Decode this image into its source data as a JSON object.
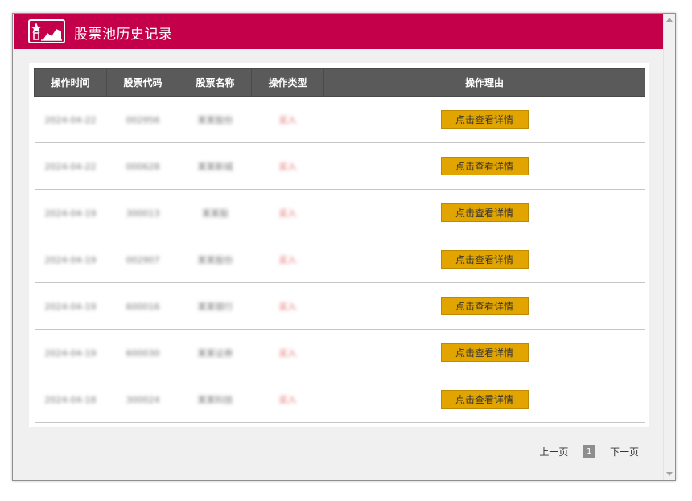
{
  "header": {
    "title": "股票池历史记录",
    "background_color": "#c5004a"
  },
  "table": {
    "columns": [
      "操作时间",
      "股票代码",
      "股票名称",
      "操作类型",
      "操作理由"
    ],
    "rows": [
      {
        "time": "2024-04-22",
        "code": "002956",
        "name": "某某股份",
        "type": "买入",
        "reason_button": "点击查看详情"
      },
      {
        "time": "2024-04-22",
        "code": "000628",
        "name": "某某新城",
        "type": "买入",
        "reason_button": "点击查看详情"
      },
      {
        "time": "2024-04-19",
        "code": "300013",
        "name": "某某股",
        "type": "买入",
        "reason_button": "点击查看详情"
      },
      {
        "time": "2024-04-19",
        "code": "002907",
        "name": "某某股份",
        "type": "买入",
        "reason_button": "点击查看详情"
      },
      {
        "time": "2024-04-19",
        "code": "600016",
        "name": "某某银行",
        "type": "买入",
        "reason_button": "点击查看详情"
      },
      {
        "time": "2024-04-19",
        "code": "600030",
        "name": "某某证券",
        "type": "买入",
        "reason_button": "点击查看详情"
      },
      {
        "time": "2024-04-18",
        "code": "300024",
        "name": "某某科技",
        "type": "买入",
        "reason_button": "点击查看详情"
      }
    ],
    "button_color": "#e2a500"
  },
  "pagination": {
    "prev": "上一页",
    "current": "1",
    "next": "下一页"
  }
}
